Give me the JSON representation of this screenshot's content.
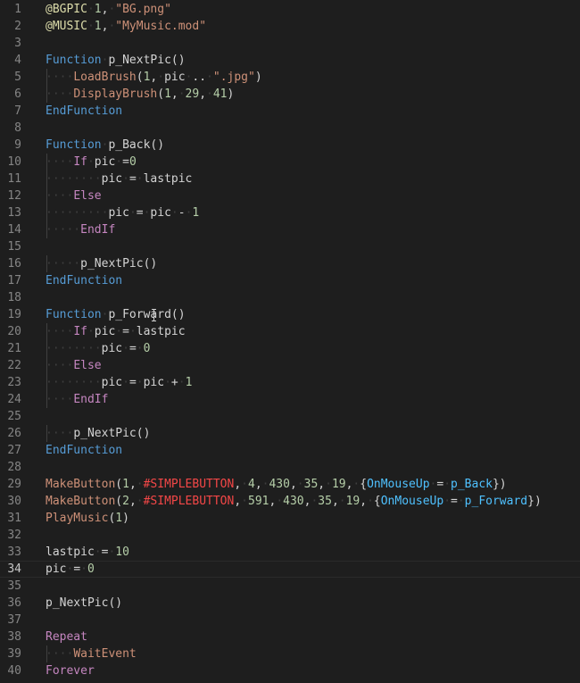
{
  "editor": {
    "language": "Hollywood",
    "current_line": 34,
    "lines": [
      {
        "n": "1",
        "t": [
          [
            "dir",
            "@BGPIC"
          ],
          [
            "ws",
            "·"
          ],
          [
            "num",
            "1"
          ],
          [
            "id",
            ","
          ],
          [
            "ws",
            "·"
          ],
          [
            "str",
            "\"BG.png\""
          ]
        ]
      },
      {
        "n": "2",
        "t": [
          [
            "dir",
            "@MUSIC"
          ],
          [
            "ws",
            "·"
          ],
          [
            "num",
            "1"
          ],
          [
            "id",
            ","
          ],
          [
            "ws",
            "·"
          ],
          [
            "str",
            "\"MyMusic.mod\""
          ]
        ]
      },
      {
        "n": "3",
        "t": []
      },
      {
        "n": "4",
        "t": [
          [
            "fn-kw",
            "Function"
          ],
          [
            "ws",
            "·"
          ],
          [
            "id",
            "p_NextPic()"
          ]
        ]
      },
      {
        "n": "5",
        "t": [
          [
            "ws",
            "····"
          ],
          [
            "call",
            "LoadBrush"
          ],
          [
            "id",
            "("
          ],
          [
            "num",
            "1"
          ],
          [
            "id",
            ","
          ],
          [
            "ws",
            "·"
          ],
          [
            "id",
            "pic"
          ],
          [
            "ws",
            "·"
          ],
          [
            "id",
            ".."
          ],
          [
            "ws",
            "·"
          ],
          [
            "str",
            "\".jpg\""
          ],
          [
            "id",
            ")"
          ]
        ]
      },
      {
        "n": "6",
        "t": [
          [
            "ws",
            "····"
          ],
          [
            "call",
            "DisplayBrush"
          ],
          [
            "id",
            "("
          ],
          [
            "num",
            "1"
          ],
          [
            "id",
            ","
          ],
          [
            "ws",
            "·"
          ],
          [
            "num",
            "29"
          ],
          [
            "id",
            ","
          ],
          [
            "ws",
            "·"
          ],
          [
            "num",
            "41"
          ],
          [
            "id",
            ")"
          ]
        ]
      },
      {
        "n": "7",
        "t": [
          [
            "fn-kw",
            "EndFunction"
          ]
        ]
      },
      {
        "n": "8",
        "t": []
      },
      {
        "n": "9",
        "t": [
          [
            "fn-kw",
            "Function"
          ],
          [
            "ws",
            "·"
          ],
          [
            "id",
            "p_Back()"
          ]
        ]
      },
      {
        "n": "10",
        "t": [
          [
            "ws",
            "····"
          ],
          [
            "kw",
            "If"
          ],
          [
            "ws",
            "·"
          ],
          [
            "id",
            "pic"
          ],
          [
            "ws",
            "·"
          ],
          [
            "id",
            "="
          ],
          [
            "num",
            "0"
          ]
        ]
      },
      {
        "n": "11",
        "t": [
          [
            "ws",
            "········"
          ],
          [
            "id",
            "pic"
          ],
          [
            "ws",
            "·"
          ],
          [
            "id",
            "="
          ],
          [
            "ws",
            "·"
          ],
          [
            "id",
            "lastpic"
          ]
        ]
      },
      {
        "n": "12",
        "t": [
          [
            "ws",
            "····"
          ],
          [
            "kw",
            "Else"
          ]
        ]
      },
      {
        "n": "13",
        "t": [
          [
            "ws",
            "·········"
          ],
          [
            "id",
            "pic"
          ],
          [
            "ws",
            "·"
          ],
          [
            "id",
            "="
          ],
          [
            "ws",
            "·"
          ],
          [
            "id",
            "pic"
          ],
          [
            "ws",
            "·"
          ],
          [
            "id",
            "-"
          ],
          [
            "ws",
            "·"
          ],
          [
            "num",
            "1"
          ]
        ]
      },
      {
        "n": "14",
        "t": [
          [
            "ws",
            "·····"
          ],
          [
            "kw",
            "EndIf"
          ]
        ]
      },
      {
        "n": "15",
        "t": []
      },
      {
        "n": "16",
        "t": [
          [
            "ws",
            "·····"
          ],
          [
            "id",
            "p_NextPic()"
          ]
        ]
      },
      {
        "n": "17",
        "t": [
          [
            "fn-kw",
            "EndFunction"
          ]
        ]
      },
      {
        "n": "18",
        "t": []
      },
      {
        "n": "19",
        "t": [
          [
            "fn-kw",
            "Function"
          ],
          [
            "ws",
            "·"
          ],
          [
            "id",
            "p_Forward()"
          ]
        ]
      },
      {
        "n": "20",
        "t": [
          [
            "ws",
            "····"
          ],
          [
            "kw",
            "If"
          ],
          [
            "ws",
            "·"
          ],
          [
            "id",
            "pic"
          ],
          [
            "ws",
            "·"
          ],
          [
            "id",
            "="
          ],
          [
            "ws",
            "·"
          ],
          [
            "id",
            "lastpic"
          ]
        ]
      },
      {
        "n": "21",
        "t": [
          [
            "ws",
            "········"
          ],
          [
            "id",
            "pic"
          ],
          [
            "ws",
            "·"
          ],
          [
            "id",
            "="
          ],
          [
            "ws",
            "·"
          ],
          [
            "num",
            "0"
          ]
        ]
      },
      {
        "n": "22",
        "t": [
          [
            "ws",
            "····"
          ],
          [
            "kw",
            "Else"
          ]
        ]
      },
      {
        "n": "23",
        "t": [
          [
            "ws",
            "········"
          ],
          [
            "id",
            "pic"
          ],
          [
            "ws",
            "·"
          ],
          [
            "id",
            "="
          ],
          [
            "ws",
            "·"
          ],
          [
            "id",
            "pic"
          ],
          [
            "ws",
            "·"
          ],
          [
            "id",
            "+"
          ],
          [
            "ws",
            "·"
          ],
          [
            "num",
            "1"
          ]
        ]
      },
      {
        "n": "24",
        "t": [
          [
            "ws",
            "····"
          ],
          [
            "kw",
            "EndIf"
          ]
        ]
      },
      {
        "n": "25",
        "t": []
      },
      {
        "n": "26",
        "t": [
          [
            "ws",
            "····"
          ],
          [
            "id",
            "p_NextPic()"
          ]
        ]
      },
      {
        "n": "27",
        "t": [
          [
            "fn-kw",
            "EndFunction"
          ]
        ]
      },
      {
        "n": "28",
        "t": []
      },
      {
        "n": "29",
        "t": [
          [
            "call",
            "MakeButton"
          ],
          [
            "id",
            "("
          ],
          [
            "num",
            "1"
          ],
          [
            "id",
            ","
          ],
          [
            "ws",
            "·"
          ],
          [
            "const",
            "#SIMPLEBUTTON"
          ],
          [
            "id",
            ","
          ],
          [
            "ws",
            "·"
          ],
          [
            "num",
            "4"
          ],
          [
            "id",
            ","
          ],
          [
            "ws",
            "·"
          ],
          [
            "num",
            "430"
          ],
          [
            "id",
            ","
          ],
          [
            "ws",
            "·"
          ],
          [
            "num",
            "35"
          ],
          [
            "id",
            ","
          ],
          [
            "ws",
            "·"
          ],
          [
            "num",
            "19"
          ],
          [
            "id",
            ","
          ],
          [
            "ws",
            "·"
          ],
          [
            "id",
            "{"
          ],
          [
            "ev",
            "OnMouseUp"
          ],
          [
            "ws",
            "·"
          ],
          [
            "id",
            "="
          ],
          [
            "ws",
            "·"
          ],
          [
            "ev",
            "p_Back"
          ],
          [
            "id",
            "})"
          ]
        ]
      },
      {
        "n": "30",
        "t": [
          [
            "call",
            "MakeButton"
          ],
          [
            "id",
            "("
          ],
          [
            "num",
            "2"
          ],
          [
            "id",
            ","
          ],
          [
            "ws",
            "·"
          ],
          [
            "const",
            "#SIMPLEBUTTON"
          ],
          [
            "id",
            ","
          ],
          [
            "ws",
            "·"
          ],
          [
            "num",
            "591"
          ],
          [
            "id",
            ","
          ],
          [
            "ws",
            "·"
          ],
          [
            "num",
            "430"
          ],
          [
            "id",
            ","
          ],
          [
            "ws",
            "·"
          ],
          [
            "num",
            "35"
          ],
          [
            "id",
            ","
          ],
          [
            "ws",
            "·"
          ],
          [
            "num",
            "19"
          ],
          [
            "id",
            ","
          ],
          [
            "ws",
            "·"
          ],
          [
            "id",
            "{"
          ],
          [
            "ev",
            "OnMouseUp"
          ],
          [
            "ws",
            "·"
          ],
          [
            "id",
            "="
          ],
          [
            "ws",
            "·"
          ],
          [
            "ev",
            "p_Forward"
          ],
          [
            "id",
            "})"
          ]
        ]
      },
      {
        "n": "31",
        "t": [
          [
            "call",
            "PlayMusic"
          ],
          [
            "id",
            "("
          ],
          [
            "num",
            "1"
          ],
          [
            "id",
            ")"
          ]
        ]
      },
      {
        "n": "32",
        "t": []
      },
      {
        "n": "33",
        "t": [
          [
            "id",
            "lastpic"
          ],
          [
            "ws",
            "·"
          ],
          [
            "id",
            "="
          ],
          [
            "ws",
            "·"
          ],
          [
            "num",
            "10"
          ]
        ]
      },
      {
        "n": "34",
        "t": [
          [
            "id",
            "pic"
          ],
          [
            "ws",
            "·"
          ],
          [
            "id",
            "="
          ],
          [
            "ws",
            "·"
          ],
          [
            "num",
            "0"
          ]
        ]
      },
      {
        "n": "35",
        "t": []
      },
      {
        "n": "36",
        "t": [
          [
            "id",
            "p_NextPic()"
          ]
        ]
      },
      {
        "n": "37",
        "t": []
      },
      {
        "n": "38",
        "t": [
          [
            "kw",
            "Repeat"
          ]
        ]
      },
      {
        "n": "39",
        "t": [
          [
            "ws",
            "····"
          ],
          [
            "call",
            "WaitEvent"
          ]
        ]
      },
      {
        "n": "40",
        "t": [
          [
            "kw",
            "Forever"
          ]
        ]
      }
    ]
  },
  "theme": {
    "background": "#1e1e1e",
    "line_number": "#858585",
    "keyword": "#c586c0",
    "function_keyword": "#569cd6",
    "string": "#ce9178",
    "number": "#b5cea8",
    "constant": "#f44747",
    "event": "#4fc1ff"
  }
}
